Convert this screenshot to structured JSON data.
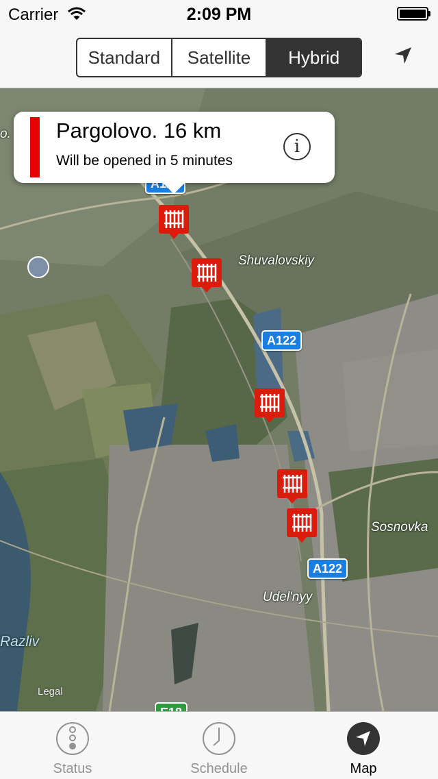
{
  "status_bar": {
    "carrier": "Carrier",
    "time": "2:09 PM"
  },
  "map_type": {
    "options": [
      "Standard",
      "Satellite",
      "Hybrid"
    ],
    "selected": "Hybrid"
  },
  "callout": {
    "title": "Pargolovo. 16 km",
    "subtitle": "Will be opened in 5 minutes",
    "status_color": "#e60000",
    "info_icon": "info-icon",
    "info_glyph": "i"
  },
  "map": {
    "road_shields": [
      "A122",
      "A122",
      "A122",
      "A122",
      "E18"
    ],
    "place_labels": [
      "Shuvalovskiy",
      "Sosnovka",
      "Udel'nyy",
      "Razliv",
      "o."
    ],
    "legal": "Legal",
    "pins": [
      "railway-crossing-pin",
      "railway-crossing-pin",
      "railway-crossing-pin",
      "railway-crossing-pin",
      "railway-crossing-pin"
    ],
    "pin_color": "#d91c0b"
  },
  "tabbar": {
    "tabs": [
      {
        "label": "Status",
        "icon": "traffic-light-icon"
      },
      {
        "label": "Schedule",
        "icon": "clock-icon"
      },
      {
        "label": "Map",
        "icon": "location-arrow-icon"
      }
    ],
    "selected": "Map"
  }
}
